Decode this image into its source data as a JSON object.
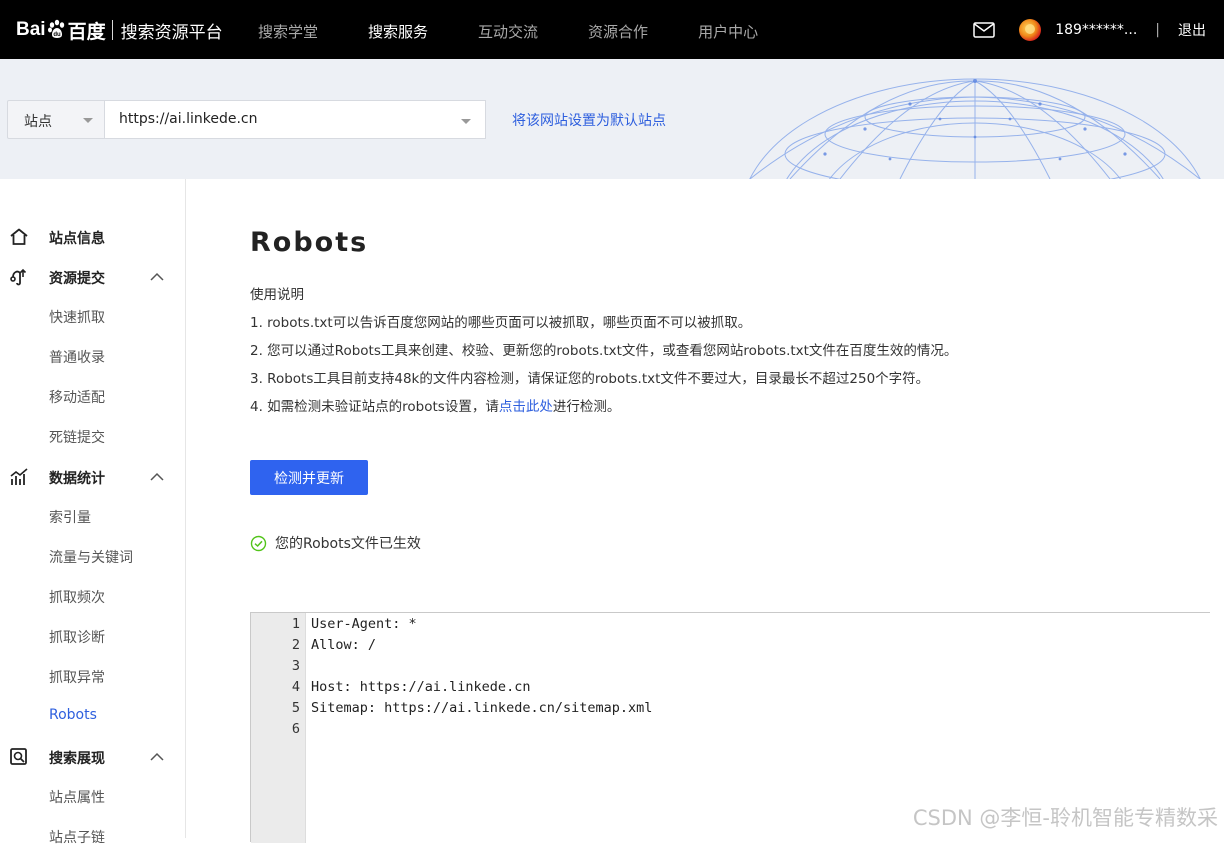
{
  "header": {
    "brand": "Bai",
    "brand_cn": "百度",
    "title": "搜索资源平台",
    "nav": [
      "搜索学堂",
      "搜索服务",
      "互动交流",
      "资源合作",
      "用户中心"
    ],
    "active_nav": "搜索服务",
    "user_phone": "189******...",
    "separator": "|",
    "logout": "退出"
  },
  "site_selector": {
    "type_label": "站点",
    "url_value": "https://ai.linkede.cn",
    "set_default_link": "将该网站设置为默认站点"
  },
  "sidebar": {
    "groups": [
      {
        "label": "站点信息",
        "icon": "home-icon"
      },
      {
        "label": "资源提交",
        "icon": "submit-icon",
        "items": [
          "快速抓取",
          "普通收录",
          "移动适配",
          "死链提交"
        ]
      },
      {
        "label": "数据统计",
        "icon": "chart-icon",
        "items": [
          "索引量",
          "流量与关键词",
          "抓取频次",
          "抓取诊断",
          "抓取异常",
          "Robots"
        ]
      },
      {
        "label": "搜索展现",
        "icon": "search-display-icon",
        "items": [
          "站点属性",
          "站点子链"
        ]
      }
    ],
    "active_item": "Robots"
  },
  "main": {
    "title": "Robots",
    "instructions_heading": "使用说明",
    "instructions": [
      "1. robots.txt可以告诉百度您网站的哪些页面可以被抓取，哪些页面不可以被抓取。",
      "2. 您可以通过Robots工具来创建、校验、更新您的robots.txt文件，或查看您网站robots.txt文件在百度生效的情况。",
      "3. Robots工具目前支持48k的文件内容检测，请保证您的robots.txt文件不要过大，目录最长不超过250个字符。"
    ],
    "instruction4_prefix": "4. 如需检测未验证站点的robots设置，请",
    "instruction4_link": "点击此处",
    "instruction4_suffix": "进行检测。",
    "check_button": "检测并更新",
    "status_text": "您的Robots文件已生效",
    "robots_lines": [
      "User-Agent: *",
      "Allow: /",
      "",
      "Host: https://ai.linkede.cn",
      "Sitemap: https://ai.linkede.cn/sitemap.xml",
      ""
    ],
    "line_numbers": [
      "1",
      "2",
      "3",
      "4",
      "5",
      "6"
    ]
  },
  "watermark": "CSDN @李恒-聆机智能专精数采",
  "colors": {
    "accent": "#2f63ef",
    "link": "#2e5fde",
    "topbar": "#000000",
    "success": "#52c41a"
  }
}
